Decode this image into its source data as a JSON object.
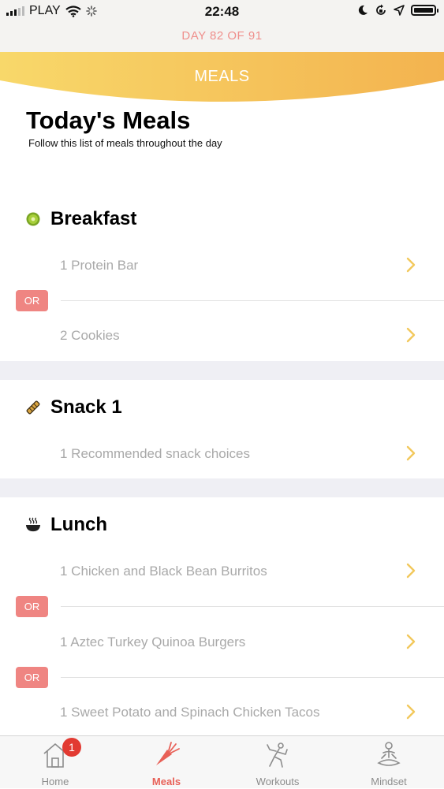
{
  "status_bar": {
    "carrier": "PLAY",
    "time": "22:48"
  },
  "program": {
    "day_label": "DAY 82 OF 91"
  },
  "header": {
    "title": "MEALS"
  },
  "page": {
    "title": "Today's Meals",
    "subtitle": "Follow this list of meals throughout the day"
  },
  "or_label": "OR",
  "meals": [
    {
      "name": "Breakfast",
      "icon": "kiwi-icon",
      "items": [
        "1 Protein Bar",
        "2 Cookies"
      ]
    },
    {
      "name": "Snack 1",
      "icon": "granola-bar-icon",
      "items": [
        "1 Recommended snack choices"
      ]
    },
    {
      "name": "Lunch",
      "icon": "soup-bowl-icon",
      "items": [
        "1 Chicken and Black Bean Burritos",
        "1 Aztec Turkey Quinoa Burgers",
        "1 Sweet Potato and Spinach Chicken Tacos"
      ]
    }
  ],
  "tabs": [
    {
      "label": "Home",
      "icon": "home-icon",
      "badge": "1"
    },
    {
      "label": "Meals",
      "icon": "carrot-icon",
      "active": true
    },
    {
      "label": "Workouts",
      "icon": "workout-icon"
    },
    {
      "label": "Mindset",
      "icon": "meditation-icon"
    }
  ],
  "colors": {
    "accent": "#ef8582",
    "banner_start": "#f8d86a",
    "banner_end": "#f3b34f",
    "chevron": "#f2c85b",
    "separator": "#efeff4"
  }
}
